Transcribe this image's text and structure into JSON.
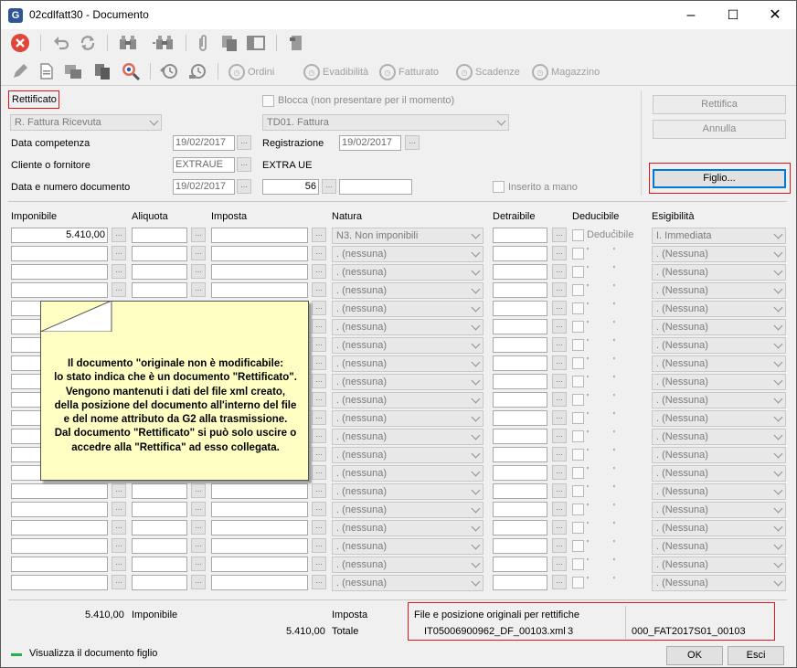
{
  "window": {
    "title": "02cdlfatt30 - Documento",
    "app_icon": "G",
    "min": "–",
    "max": "☐",
    "close": "✕"
  },
  "toolbar2": {
    "ordini": "Ordini",
    "evadibilita": "Evadibilità",
    "fatturato": "Fatturato",
    "scadenze": "Scadenze",
    "magazzino": "Magazzino"
  },
  "header": {
    "stato": "Rettificato",
    "tipo_doc": "R. Fattura Ricevuta",
    "blocca_label": "Blocca (non presentare per il momento)",
    "td_code": "TD01. Fattura",
    "data_competenza_label": "Data competenza",
    "data_competenza": "19/02/2017",
    "registrazione_label": "Registrazione",
    "registrazione": "19/02/2017",
    "cliente_label": "Cliente o fornitore",
    "cliente_code": "EXTRAUE",
    "cliente_name": "EXTRA UE",
    "data_num_label": "Data e numero documento",
    "data_doc": "19/02/2017",
    "numero_doc": "56",
    "numero_suffix": "",
    "inserito_label": "Inserito a mano",
    "rettifica_btn": "Rettifica",
    "annulla_btn": "Annulla",
    "figlio_btn": "Figlio..."
  },
  "columns": {
    "imponibile": "Imponibile",
    "aliquota": "Aliquota",
    "imposta": "Imposta",
    "natura": "Natura",
    "detraibile": "Detraibile",
    "deducibile": "Deducibile",
    "esigibilita": "Esigibilità"
  },
  "rows": [
    {
      "imponibile": "5.410,00",
      "natura": "N3. Non imponibili",
      "deducibile": "Deducibile",
      "esigibilita": "I. Immediata"
    },
    {
      "imponibile": "",
      "natura": ". (nessuna)",
      "deducibile": "",
      "esigibilita": ". (Nessuna)"
    },
    {
      "imponibile": "",
      "natura": ". (nessuna)",
      "deducibile": "",
      "esigibilita": ". (Nessuna)"
    },
    {
      "imponibile": "",
      "natura": ". (nessuna)",
      "deducibile": "",
      "esigibilita": ". (Nessuna)"
    },
    {
      "imponibile": "",
      "natura": ". (nessuna)",
      "deducibile": "",
      "esigibilita": ". (Nessuna)"
    },
    {
      "imponibile": "",
      "natura": ". (nessuna)",
      "deducibile": "",
      "esigibilita": ". (Nessuna)"
    },
    {
      "imponibile": "",
      "natura": ". (nessuna)",
      "deducibile": "",
      "esigibilita": ". (Nessuna)"
    },
    {
      "imponibile": "",
      "natura": ". (nessuna)",
      "deducibile": "",
      "esigibilita": ". (Nessuna)"
    },
    {
      "imponibile": "",
      "natura": ". (nessuna)",
      "deducibile": "",
      "esigibilita": ". (Nessuna)"
    },
    {
      "imponibile": "",
      "natura": ". (nessuna)",
      "deducibile": "",
      "esigibilita": ". (Nessuna)"
    },
    {
      "imponibile": "",
      "natura": ". (nessuna)",
      "deducibile": "",
      "esigibilita": ". (Nessuna)"
    },
    {
      "imponibile": "",
      "natura": ". (nessuna)",
      "deducibile": "",
      "esigibilita": ". (Nessuna)"
    },
    {
      "imponibile": "",
      "natura": ". (nessuna)",
      "deducibile": "",
      "esigibilita": ". (Nessuna)"
    },
    {
      "imponibile": "",
      "natura": ". (nessuna)",
      "deducibile": "",
      "esigibilita": ". (Nessuna)"
    },
    {
      "imponibile": "",
      "natura": ". (nessuna)",
      "deducibile": "",
      "esigibilita": ". (Nessuna)"
    },
    {
      "imponibile": "",
      "natura": ". (nessuna)",
      "deducibile": "",
      "esigibilita": ". (Nessuna)"
    },
    {
      "imponibile": "",
      "natura": ". (nessuna)",
      "deducibile": "",
      "esigibilita": ". (Nessuna)"
    },
    {
      "imponibile": "",
      "natura": ". (nessuna)",
      "deducibile": "",
      "esigibilita": ". (Nessuna)"
    },
    {
      "imponibile": "",
      "natura": ". (nessuna)",
      "deducibile": "",
      "esigibilita": ". (Nessuna)"
    },
    {
      "imponibile": "",
      "natura": ". (nessuna)",
      "deducibile": "",
      "esigibilita": ". (Nessuna)"
    }
  ],
  "callout": {
    "text": "Il documento \"originale non è modificabile:\nlo stato indica che è un documento \"Rettificato\".\nVengono mantenuti i dati del file xml creato,\ndella posizione del documento all'interno del file\ne del nome attributo da G2 alla trasmissione.\nDal documento \"Rettificato\" si può solo uscire o\naccedre alla \"Rettifica\" ad esso collegata."
  },
  "totals": {
    "imponibile_value": "5.410,00",
    "imponibile_label": "Imponibile",
    "imposta_label": "Imposta",
    "totale_value": "5.410,00",
    "totale_label": "Totale",
    "file_title": "File e posizione originali per rettifiche",
    "file_name": "IT05006900962_DF_00103.xml",
    "file_pos": "3",
    "attr_name": "000_FAT2017S01_00103"
  },
  "footer": {
    "link": "Visualizza il documento figlio",
    "ok": "OK",
    "esci": "Esci"
  },
  "colors": {
    "accent_red": "#e0161b",
    "callout_bg": "#ffffc4",
    "focus_blue": "#0078d7",
    "green": "#22b14c"
  }
}
